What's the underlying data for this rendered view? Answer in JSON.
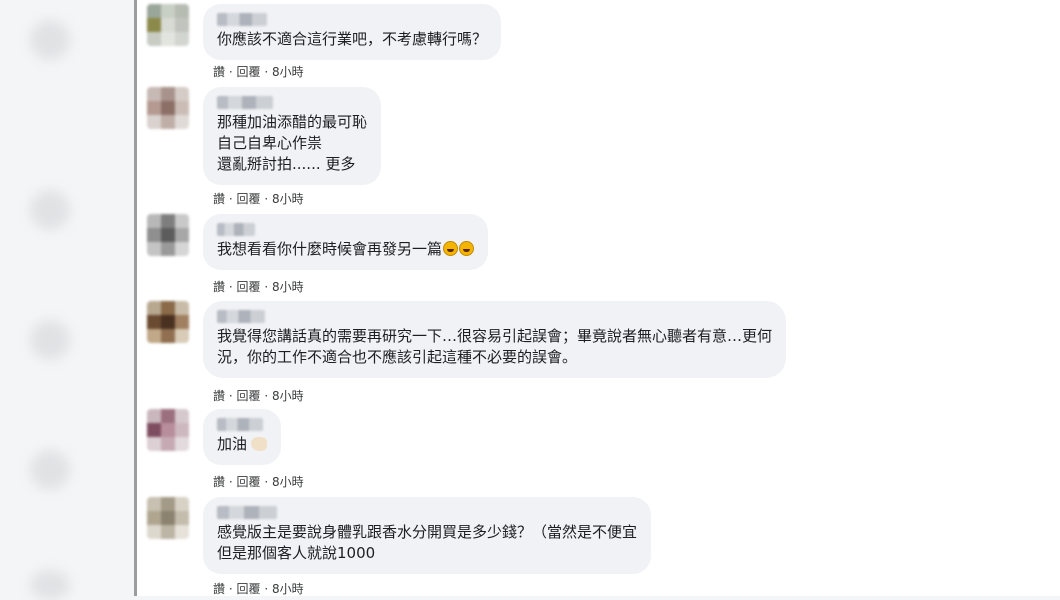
{
  "comments": [
    {
      "lines": [
        "你應該不適合這行業吧，不考慮轉行嗎？"
      ],
      "actions": {
        "like": "讚",
        "reply": "回覆",
        "time": "8小時"
      }
    },
    {
      "lines": [
        "那種加油添醋的最可恥",
        "自己自卑心作祟",
        "還亂掰討拍......",
        "更多"
      ],
      "actions": {
        "like": "讚",
        "reply": "回覆",
        "time": "8小時"
      }
    },
    {
      "lines": [
        "我想看看你什麼時候會再發另一篇"
      ],
      "emoji_icon": "laughing-crying-emoji-icon",
      "actions": {
        "like": "讚",
        "reply": "回覆",
        "time": "8小時"
      }
    },
    {
      "lines": [
        "我覺得您講話真的需要再研究一下…很容易引起誤會；畢竟說者無心聽者有意…更何",
        "況，你的工作不適合也不應該引起這種不必要的誤會。"
      ],
      "actions": {
        "like": "讚",
        "reply": "回覆",
        "time": "8小時"
      }
    },
    {
      "lines": [
        "加油"
      ],
      "emoji_icon": "flexed-biceps-icon",
      "actions": {
        "like": "讚",
        "reply": "回覆",
        "time": "8小時"
      }
    },
    {
      "lines": [
        "感覺版主是要說身體乳跟香水分開買是多少錢？（當然是不便宜",
        "但是那個客人就說1000"
      ],
      "actions": {
        "like": "讚",
        "reply": "回覆",
        "time": "8小時"
      }
    }
  ],
  "separator": "·",
  "colors": {
    "bubble": "#f0f2f5",
    "text": "#1c1e21",
    "meta": "#3a3b3c",
    "border": "#9a9ca0"
  }
}
